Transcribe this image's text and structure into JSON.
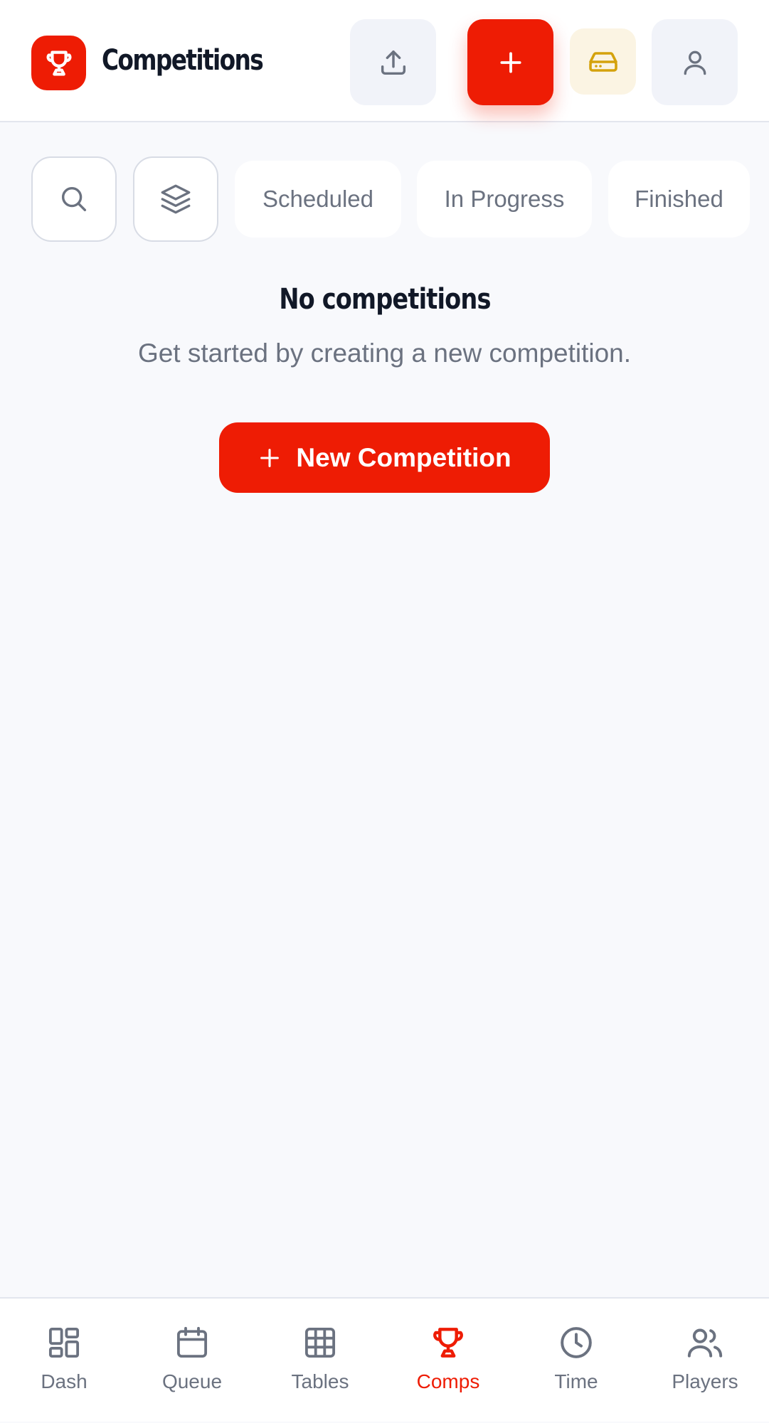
{
  "header": {
    "title": "Competitions",
    "logo_icon": "trophy-icon",
    "buttons": {
      "upload_icon": "upload-icon",
      "add_icon": "plus-icon",
      "storage_icon": "hard-drive-icon",
      "profile_icon": "user-icon"
    }
  },
  "filters": {
    "search_icon": "search-icon",
    "layers_icon": "layers-icon",
    "chips": [
      "Scheduled",
      "In Progress",
      "Finished"
    ]
  },
  "empty_state": {
    "title": "No competitions",
    "subtitle": "Get started by creating a new competition.",
    "button_label": "New Competition"
  },
  "nav": {
    "items": [
      {
        "label": "Dash",
        "icon": "dashboard-icon"
      },
      {
        "label": "Queue",
        "icon": "calendar-icon"
      },
      {
        "label": "Tables",
        "icon": "grid-icon"
      },
      {
        "label": "Comps",
        "icon": "trophy-icon",
        "active": true
      },
      {
        "label": "Time",
        "icon": "clock-icon"
      },
      {
        "label": "Players",
        "icon": "users-icon"
      }
    ]
  },
  "colors": {
    "accent": "#ee1c04",
    "storage_accent": "#d4a20c",
    "text_dark": "#111827",
    "text_muted": "#6b7280",
    "background": "#f8f9fc"
  }
}
